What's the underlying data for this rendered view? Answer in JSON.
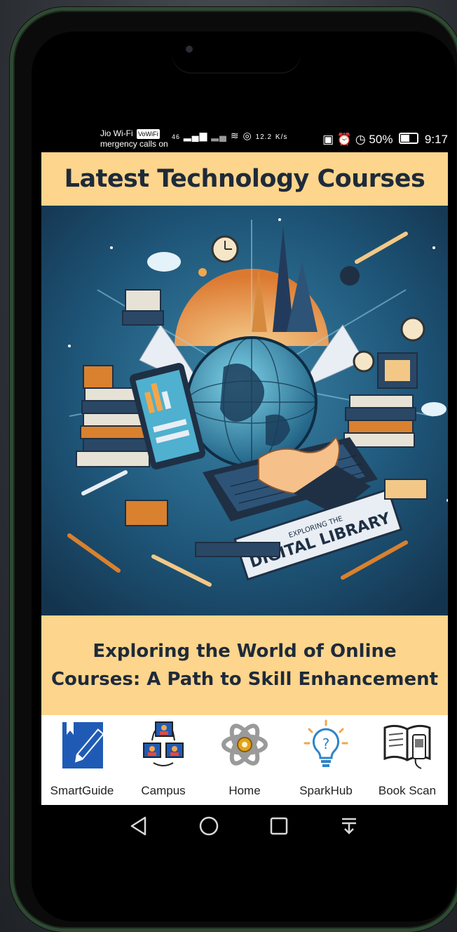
{
  "status_bar": {
    "carrier": "Jio Wi-Fi",
    "volte": "VoWiFi",
    "emergency": "mergency calls on",
    "network_small": "46",
    "speed": "12.2",
    "speed_unit": "K/s",
    "battery": "50%",
    "time": "9:17"
  },
  "header": {
    "title": "Latest Technology Courses"
  },
  "hero": {
    "banner_text": "DIGITAL LIBRARY",
    "banner_subtext": "EXPLORING THE"
  },
  "caption": {
    "line1": "Exploring the World of Online",
    "line2": "Courses: A Path to Skill Enhancement"
  },
  "bottom_nav": {
    "items": [
      {
        "label": "SmartGuide",
        "icon": "smartguide-icon"
      },
      {
        "label": "Campus",
        "icon": "campus-icon"
      },
      {
        "label": "Home",
        "icon": "home-icon"
      },
      {
        "label": "SparkHub",
        "icon": "sparkhub-icon"
      },
      {
        "label": "Book Scan",
        "icon": "book-scan-icon"
      }
    ]
  },
  "colors": {
    "accent_yellow": "#fdd58c",
    "text_dark": "#1e2a3a",
    "smartguide_blue": "#1f5bb5"
  }
}
